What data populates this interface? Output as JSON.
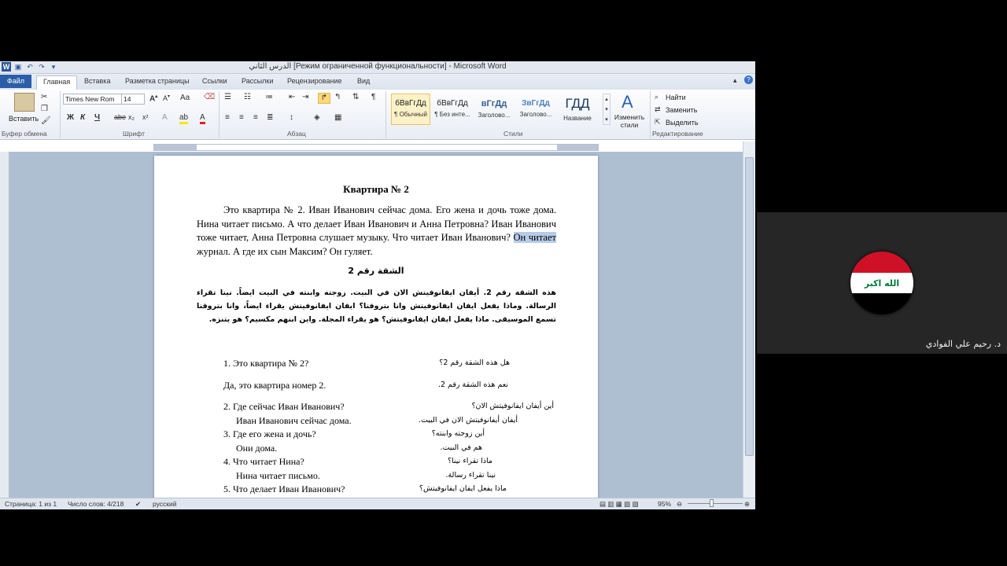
{
  "titlebar": {
    "title": "الدرس الثاني [Режим ограниченной функциональности] - Microsoft Word",
    "app_icon": "W"
  },
  "tabs": {
    "file": "Файл",
    "items": [
      "Главная",
      "Вставка",
      "Разметка страницы",
      "Ссылки",
      "Рассылки",
      "Рецензирование",
      "Вид"
    ],
    "active": "Главная"
  },
  "ribbon": {
    "clipboard": {
      "paste": "Вставить",
      "label": "Буфер обмена"
    },
    "font": {
      "name": "Times New Rom",
      "size": "14",
      "change_case": "Aa",
      "bold": "Ж",
      "italic": "К",
      "underline": "Ч",
      "strike": "abe",
      "subscript": "x₂",
      "superscript": "x²",
      "label": "Шрифт"
    },
    "paragraph": {
      "label": "Абзац",
      "pilcrow": "¶"
    },
    "styles": {
      "items": [
        {
          "preview": "бВвГгДд",
          "name": "¶ Обычный",
          "selected": true
        },
        {
          "preview": "бВвГгДд",
          "name": "¶ Без инте...",
          "selected": false
        },
        {
          "preview": "вГгДд",
          "name": "Заголово...",
          "selected": false
        },
        {
          "preview": "ЗвГгДд",
          "name": "Заголово...",
          "selected": false
        },
        {
          "preview": "ГДД",
          "name": "Название",
          "selected": false
        }
      ],
      "change": "Изменить стили",
      "label": "Стили"
    },
    "editing": {
      "find": "Найти",
      "replace": "Заменить",
      "select": "Выделить",
      "label": "Редактирование"
    }
  },
  "document": {
    "heading_ru": "Квартира № 2",
    "para_ru_before": "Это квартира № 2. Иван Иванович сейчас дома. Его жена и дочь тоже дома. Нина читает письмо. А что делает Иван Иванович и Анна Петровна? Иван Иванович тоже читает, Анна Петровна слушает музыку. Что читает Иван Иванович? ",
    "para_ru_selected": "Он читает",
    "para_ru_after": " журнал. А где их сын Максим? Он гуляет.",
    "heading_ar": "الشقة رقم 2",
    "para_ar": "هذه الشقة رقم 2. أيفان ايفانوفيتش الان في البيت. زوجته وابنته في البيت ايضاً. نينا تقراء الرسالة. وماذا يفعل ايفان ايفانوفيتش وانا بتروفنا؟ ايفان ايفانوفيتش يقراء ايضاً، وانا بتروفنا تسمع الموسيقى. ماذا يفعل ايفان ايفانوفيتش؟  هو يقراء المجلة. واين ابنهم مكسيم؟ هو يتنزه.",
    "qa": [
      {
        "ru": "1.  Это квартира № 2?",
        "ar": "هل هذه الشقة رقم 2؟"
      },
      {
        "ru": "Да, это квартира номер 2.",
        "ar": "نعم هذه الشقة رقم 2."
      },
      {
        "ru": "2.  Где сейчас Иван Иванович?",
        "ar": "أين  أيفان ايفانوفيتش الان؟"
      },
      {
        "ru": "Иван Иванович сейчас дома.",
        "ar": "أيفان أيفانوفيتش الان في البيت."
      },
      {
        "ru": "3.  Где его жена и дочь?",
        "ar": "أين زوجته وابنته؟"
      },
      {
        "ru": "Они дома.",
        "ar": "هم في البيت."
      },
      {
        "ru": "4.  Что читает Нина?",
        "ar": "ماذا تقراء نينا؟"
      },
      {
        "ru": "Нина читает письмо.",
        "ar": "نينا تقراء رسالة."
      },
      {
        "ru": "5.  Что делает Иван Иванович?",
        "ar": "ماذا يفعل ايفان ايفانوفيتش؟"
      }
    ]
  },
  "statusbar": {
    "page": "Страница: 1 из 1",
    "words": "Число слов: 4/218",
    "language": "русский",
    "zoom": "95%"
  },
  "video": {
    "participant_name": "د. رحيم علي الفوادي",
    "flag_text": "الله اكبر",
    "colors": {
      "red": "#ce1126",
      "white": "#ffffff",
      "black": "#000000",
      "green": "#007a3d"
    }
  }
}
